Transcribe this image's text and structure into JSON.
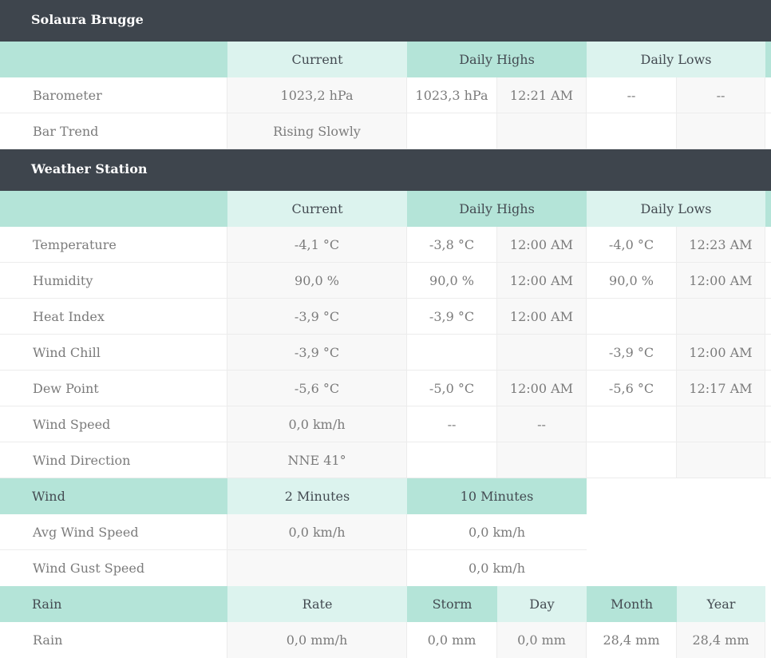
{
  "station": {
    "title": "Solaura Brugge"
  },
  "barometer_table": {
    "headers": {
      "current": "Current",
      "highs": "Daily Highs",
      "lows": "Daily Lows"
    },
    "rows": [
      {
        "label": "Barometer",
        "current": "1023,2 hPa",
        "high": "1023,3 hPa",
        "high_time": "12:21 AM",
        "low": "--",
        "low_time": "--"
      },
      {
        "label": "Bar Trend",
        "current": "Rising Slowly",
        "high": "",
        "high_time": "",
        "low": "",
        "low_time": ""
      }
    ]
  },
  "weather_station": {
    "title": "Weather Station",
    "headers": {
      "current": "Current",
      "highs": "Daily Highs",
      "lows": "Daily Lows"
    },
    "rows": [
      {
        "label": "Temperature",
        "current": "-4,1 °C",
        "high": "-3,8 °C",
        "high_time": "12:00 AM",
        "low": "-4,0 °C",
        "low_time": "12:23 AM"
      },
      {
        "label": "Humidity",
        "current": "90,0 %",
        "high": "90,0 %",
        "high_time": "12:00 AM",
        "low": "90,0 %",
        "low_time": "12:00 AM"
      },
      {
        "label": "Heat Index",
        "current": "-3,9 °C",
        "high": "-3,9 °C",
        "high_time": "12:00 AM",
        "low": "",
        "low_time": ""
      },
      {
        "label": "Wind Chill",
        "current": "-3,9 °C",
        "high": "",
        "high_time": "",
        "low": "-3,9 °C",
        "low_time": "12:00 AM"
      },
      {
        "label": "Dew Point",
        "current": "-5,6 °C",
        "high": "-5,0 °C",
        "high_time": "12:00 AM",
        "low": "-5,6 °C",
        "low_time": "12:17 AM"
      },
      {
        "label": "Wind Speed",
        "current": "0,0 km/h",
        "high": "--",
        "high_time": "--",
        "low": "",
        "low_time": ""
      },
      {
        "label": "Wind Direction",
        "current": "NNE 41°",
        "high": "",
        "high_time": "",
        "low": "",
        "low_time": ""
      }
    ]
  },
  "wind": {
    "headers": {
      "label": "Wind",
      "two_min": "2 Minutes",
      "ten_min": "10 Minutes"
    },
    "rows": [
      {
        "label": "Avg Wind Speed",
        "two_min": "0,0 km/h",
        "ten_min": "0,0 km/h"
      },
      {
        "label": "Wind Gust Speed",
        "two_min": "",
        "ten_min": "0,0 km/h"
      }
    ]
  },
  "rain": {
    "headers": {
      "label": "Rain",
      "rate": "Rate",
      "storm": "Storm",
      "day": "Day",
      "month": "Month",
      "year": "Year"
    },
    "rows": [
      {
        "label": "Rain",
        "rate": "0,0 mm/h",
        "storm": "0,0 mm",
        "day": "0,0 mm",
        "month": "28,4 mm",
        "year": "28,4 mm"
      }
    ]
  }
}
